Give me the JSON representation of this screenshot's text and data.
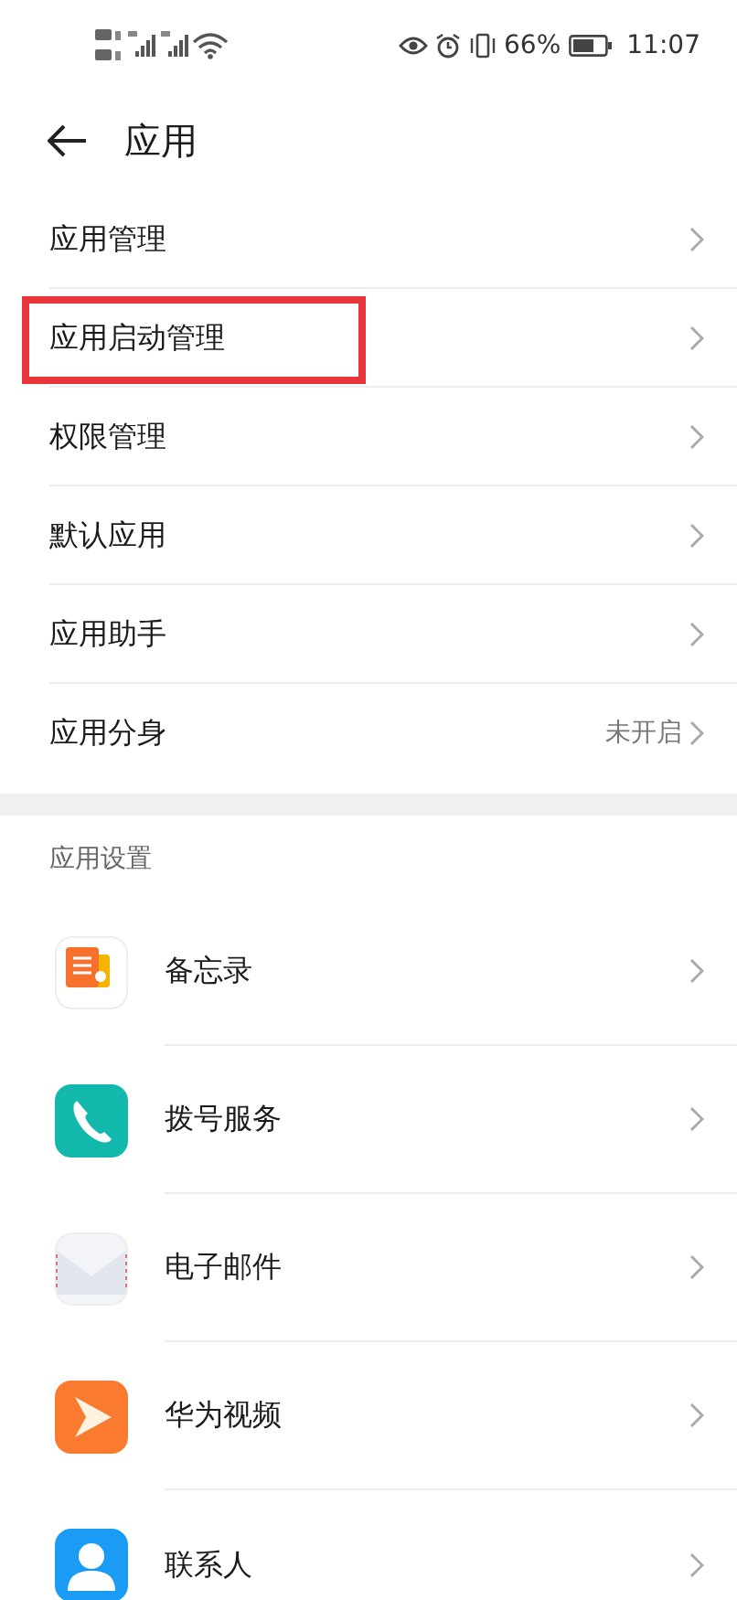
{
  "status_bar": {
    "battery_text": "66%",
    "time": "11:07"
  },
  "header": {
    "title": "应用"
  },
  "menu": [
    {
      "label": "应用管理",
      "highlighted": false
    },
    {
      "label": "应用启动管理",
      "highlighted": true
    },
    {
      "label": "权限管理",
      "highlighted": false
    },
    {
      "label": "默认应用",
      "highlighted": false
    },
    {
      "label": "应用助手",
      "highlighted": false
    },
    {
      "label": "应用分身",
      "value": "未开启",
      "highlighted": false
    }
  ],
  "section": {
    "title": "应用设置"
  },
  "apps": [
    {
      "name": "备忘录",
      "kind": "notes"
    },
    {
      "name": "拨号服务",
      "kind": "phone"
    },
    {
      "name": "电子邮件",
      "kind": "mail"
    },
    {
      "name": "华为视频",
      "kind": "video"
    },
    {
      "name": "联系人",
      "kind": "contacts"
    }
  ]
}
